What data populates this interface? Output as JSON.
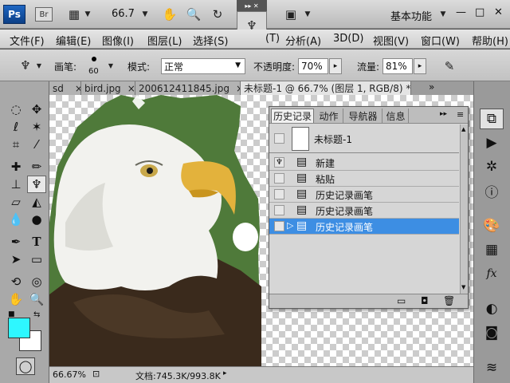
{
  "appbar": {
    "logo": "Ps",
    "bridge": "Br",
    "zoom": "66.7",
    "workspace": "基本功能",
    "win_min": "—",
    "win_max": "□",
    "win_close": "✕"
  },
  "menus": [
    "文件(F)",
    "编辑(E)",
    "图像(I)",
    "图层(L)",
    "选择(S)",
    "(T)",
    "分析(A)",
    "3D(D)",
    "视图(V)",
    "窗口(W)",
    "帮助(H)"
  ],
  "options": {
    "brush_label": "画笔:",
    "brush_size": "60",
    "mode_label": "模式:",
    "mode_value": "正常",
    "opacity_label": "不透明度:",
    "opacity_value": "70%",
    "flow_label": "流量:",
    "flow_value": "81%"
  },
  "tabs": [
    {
      "label": "sd",
      "close": "×"
    },
    {
      "label": "bird.jpg",
      "close": "×"
    },
    {
      "label": "200612411845.jpg",
      "close": "×"
    },
    {
      "label": "未标题-1 @ 66.7% (图层 1, RGB/8) *",
      "close": "×"
    }
  ],
  "tabs_more": "»",
  "panel": {
    "tabs": [
      "历史记录",
      "动作",
      "导航器",
      "信息"
    ],
    "menu_arrow": "▸▸",
    "snapshot_label": "未标题-1",
    "items": [
      "新建",
      "粘贴",
      "历史记录画笔",
      "历史记录画笔",
      "历史记录画笔"
    ]
  },
  "status": {
    "zoom": "66.67%",
    "doc": "文档:745.3K/993.8K"
  },
  "colors": {
    "foreground": "#2ef7ff",
    "background": "#ffffff",
    "selection": "#3d8ee3",
    "accent_teal": "#1cc4d6"
  },
  "icons": {
    "history_brush": "history-brush-icon",
    "hand": "hand-icon",
    "zoom": "zoom-icon",
    "rotate": "rotate-view-icon"
  }
}
